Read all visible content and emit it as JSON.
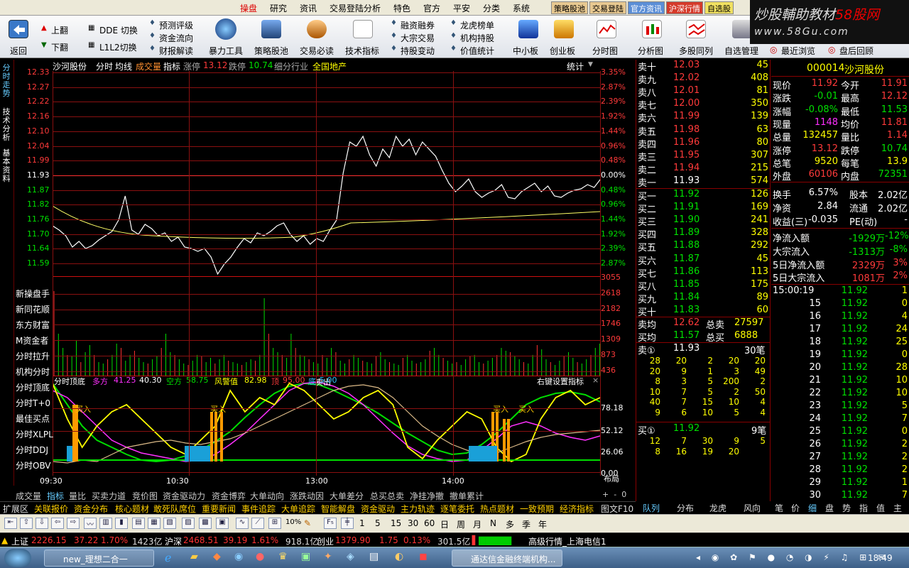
{
  "menu": {
    "items": [
      "操盘",
      "研究",
      "资讯",
      "交易登陆分析",
      "特色",
      "官方",
      "平安",
      "分类",
      "系统"
    ],
    "buttons": [
      "策略股池",
      "交易登陆",
      "官方资讯",
      "沪深行情",
      "自选股"
    ]
  },
  "watermark": {
    "line1": "炒股輔助教材",
    "line1b": "58股网",
    "line2": "www.58Gu.com"
  },
  "toolbar": {
    "back": "返回",
    "up": "上翻",
    "down": "下翻",
    "dde": "DDE 切换",
    "l1l2": "L1L2切换",
    "col1": [
      "预测评级",
      "资金流向",
      "财报解读"
    ],
    "power": "暴力工具",
    "strategy": "策略股池",
    "trade": "交易必读",
    "tech": "技术指标",
    "col2": [
      "融资融券",
      "大宗交易",
      "持股变动"
    ],
    "col3": [
      "龙虎榜单",
      "机构持股",
      "价值统计"
    ],
    "small": "中小板",
    "gem": "创业板",
    "timechart": "分时图",
    "analysis": "分析图",
    "multi": "多股同列",
    "watchlist": "自选管理",
    "recent": "最近浏览",
    "review": "盘后回顾"
  },
  "vtabs": [
    "分时走势",
    "技术分析",
    "基本资料"
  ],
  "chart": {
    "stock": "沙河股份",
    "mode": "分时",
    "avg": "均线",
    "vol": "成交量",
    "ind": "指标",
    "limit_up_lbl": "涨停",
    "limit_up": "13.12",
    "limit_dn_lbl": "跌停",
    "limit_dn": "10.74",
    "industry_lbl": "细分行业",
    "industry": "全国地产",
    "stat": "统计",
    "price_ticks": [
      "12.33",
      "12.27",
      "12.22",
      "12.16",
      "12.10",
      "12.04",
      "11.99",
      "11.93",
      "11.87",
      "11.82",
      "11.76",
      "11.70",
      "11.64",
      "11.59"
    ],
    "pct_ticks": [
      "3.35%",
      "2.87%",
      "2.39%",
      "1.92%",
      "1.44%",
      "0.96%",
      "0.48%",
      "0.00%",
      "0.48%",
      "0.96%",
      "1.44%",
      "1.92%",
      "2.39%",
      "2.87%"
    ],
    "vol_ticks": [
      "3055",
      "2618",
      "2182",
      "1746",
      "1309",
      "873",
      "436"
    ],
    "left_labels": [
      "新操盘手",
      "新同花顺",
      "东方财富",
      "M资金者",
      "分时拉升",
      "机构分时",
      "分时顶底",
      "分时T+0",
      "最佳买点",
      "分时XLPL",
      "分时DDJ",
      "分时OBV"
    ],
    "ind_title": "分时顶底",
    "ind_duo_lbl": "多方",
    "ind_duo": "41.25",
    "ind_duo2": "40.30",
    "ind_kong_lbl": "空方",
    "ind_kong": "58.75",
    "ind_risk_lbl": "风警值",
    "ind_risk": "82.98",
    "ind_top_lbl": "顶",
    "ind_top": "95.00",
    "ind_bot_lbl": "底",
    "ind_bot": "5.00",
    "ind_hint": "右键设置指标",
    "ind_ticks": [
      "78.18",
      "52.12",
      "26.06",
      "0.00"
    ],
    "times": [
      "09:30",
      "10:30",
      "13:00",
      "14:00"
    ],
    "buy_label": "买入",
    "sell_label": "卖出",
    "layout": "布局"
  },
  "asks": [
    [
      "卖十",
      "12.03",
      "45"
    ],
    [
      "卖九",
      "12.02",
      "408"
    ],
    [
      "卖八",
      "12.01",
      "81"
    ],
    [
      "卖七",
      "12.00",
      "350"
    ],
    [
      "卖六",
      "11.99",
      "139"
    ],
    [
      "卖五",
      "11.98",
      "63"
    ],
    [
      "卖四",
      "11.96",
      "80"
    ],
    [
      "卖三",
      "11.95",
      "307"
    ],
    [
      "卖二",
      "11.94",
      "215"
    ],
    [
      "卖一",
      "11.93",
      "574"
    ]
  ],
  "bids": [
    [
      "买一",
      "11.92",
      "126"
    ],
    [
      "买二",
      "11.91",
      "169"
    ],
    [
      "买三",
      "11.90",
      "241"
    ],
    [
      "买四",
      "11.89",
      "328"
    ],
    [
      "买五",
      "11.88",
      "292"
    ],
    [
      "买六",
      "11.87",
      "45"
    ],
    [
      "买七",
      "11.86",
      "113"
    ],
    [
      "买八",
      "11.85",
      "175"
    ],
    [
      "买九",
      "11.84",
      "89"
    ],
    [
      "买十",
      "11.83",
      "60"
    ]
  ],
  "avg_rows": {
    "sell_avg_lbl": "卖均",
    "sell_avg": "12.62",
    "sell_total_lbl": "总卖",
    "sell_total": "27597",
    "buy_avg_lbl": "买均",
    "buy_avg": "11.57",
    "buy_total_lbl": "总买",
    "buy_total": "6888"
  },
  "queue": {
    "sell_lbl": "卖①",
    "sell_price": "11.93",
    "sell_count": "30笔",
    "sell_rows": [
      [
        "28",
        "20",
        "2",
        "20",
        "20"
      ],
      [
        "20",
        "9",
        "1",
        "3",
        "49"
      ],
      [
        "8",
        "3",
        "5",
        "200",
        "2"
      ],
      [
        "10",
        "7",
        "5",
        "2",
        "50"
      ],
      [
        "40",
        "7",
        "15",
        "10",
        "4"
      ],
      [
        "9",
        "6",
        "10",
        "5",
        "4"
      ]
    ],
    "buy_lbl": "买①",
    "buy_price": "11.92",
    "buy_count": "9笔",
    "buy_rows": [
      [
        "12",
        "7",
        "30",
        "9",
        "5"
      ],
      [
        "8",
        "16",
        "19",
        "20",
        ""
      ]
    ]
  },
  "quote": {
    "code": "000014",
    "name": "沙河股份",
    "rows": [
      [
        "现价",
        "11.92",
        "今开",
        "11.91"
      ],
      [
        "涨跌",
        "-0.01",
        "最高",
        "12.12"
      ],
      [
        "涨幅",
        "-0.08%",
        "最低",
        "11.53"
      ],
      [
        "现量",
        "1148",
        "均价",
        "11.81"
      ],
      [
        "总量",
        "132457",
        "量比",
        "1.14"
      ],
      [
        "涨停",
        "13.12",
        "跌停",
        "10.74"
      ],
      [
        "总笔",
        "9520",
        "每笔",
        "13.9"
      ],
      [
        "外盘",
        "60106",
        "内盘",
        "72351"
      ]
    ],
    "rows2": [
      [
        "换手",
        "6.57%",
        "股本",
        "2.02亿"
      ],
      [
        "净资",
        "2.84",
        "流通",
        "2.02亿"
      ],
      [
        "收益(三)",
        "-0.035",
        "PE(动)",
        "-"
      ]
    ],
    "flow": [
      [
        "净流入额",
        "-1929万",
        "-12%"
      ],
      [
        "大宗流入",
        "-1313万",
        "-8%"
      ],
      [
        "5日净流入额",
        "2329万",
        "3%"
      ],
      [
        "5日大宗流入",
        "1081万",
        "2%"
      ]
    ]
  },
  "ticks": [
    [
      "15:00:19",
      "11.92",
      "1"
    ],
    [
      "15",
      "11.92",
      "0"
    ],
    [
      "16",
      "11.92",
      "4"
    ],
    [
      "17",
      "11.92",
      "24"
    ],
    [
      "18",
      "11.92",
      "25"
    ],
    [
      "19",
      "11.92",
      "0"
    ],
    [
      "20",
      "11.92",
      "28"
    ],
    [
      "21",
      "11.92",
      "10"
    ],
    [
      "22",
      "11.92",
      "10"
    ],
    [
      "23",
      "11.92",
      "5"
    ],
    [
      "24",
      "11.92",
      "7"
    ],
    [
      "25",
      "11.92",
      "0"
    ],
    [
      "26",
      "11.92",
      "2"
    ],
    [
      "27",
      "11.92",
      "2"
    ],
    [
      "28",
      "11.92",
      "2"
    ],
    [
      "29",
      "11.92",
      "1"
    ],
    [
      "30",
      "11.92",
      "7"
    ]
  ],
  "btabs1": [
    "成交量",
    "指标",
    "量比",
    "买卖力道",
    "竞价图",
    "资金驱动力",
    "资金博弈",
    "大单动向",
    "涨跌动因",
    "大单差分",
    "总买总卖",
    "净挂净撤",
    "撤单累计"
  ],
  "btabs2": [
    "扩展区",
    "关联报价",
    "资金分布",
    "核心题材",
    "敢死队席位",
    "重要新闻",
    "事件追踪",
    "大单追踪",
    "智能解盘",
    "资金驱动",
    "主力轨迹",
    "逐笔委托",
    "热点题材",
    "一致预期",
    "经济指标",
    "图文F10"
  ],
  "rtabs": [
    "队列",
    "分布",
    "龙虎",
    "风向",
    "笔",
    "价",
    "细",
    "盘",
    "势",
    "指",
    "值",
    "主"
  ],
  "tool2": [
    "1",
    "5",
    "15",
    "30",
    "60",
    "日",
    "周",
    "月",
    "N",
    "多",
    "季",
    "年"
  ],
  "idx": {
    "sh_lbl": "上证",
    "sh": "2226.15",
    "sh_chg": "37.22",
    "sh_pct": "1.70%",
    "sh_amt": "1423亿",
    "sz_lbl": "沪深",
    "sz": "2468.51",
    "sz_chg": "39.19",
    "sz_pct": "1.61%",
    "sz_amt": "918.1亿",
    "cy_lbl": "创业",
    "cy": "1379.90",
    "cy_chg": "1.75",
    "cy_pct": "0.13%",
    "cy_amt": "301.5亿",
    "feed": "高级行情_上海电信1"
  },
  "taskbar": {
    "task1": "new_理想二合一",
    "task2": "通达信金融终端机构...",
    "time": "18:49"
  }
}
